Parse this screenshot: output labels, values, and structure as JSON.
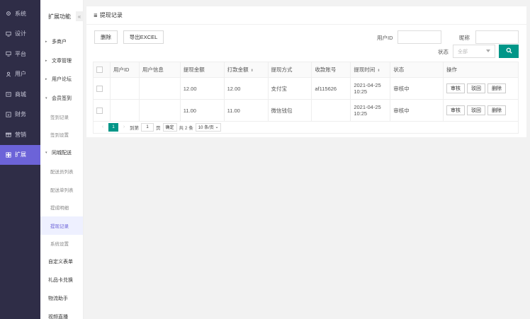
{
  "nav1": [
    {
      "label": "系统",
      "icon": "gear-icon"
    },
    {
      "label": "设计",
      "icon": "monitor-icon"
    },
    {
      "label": "平台",
      "icon": "monitor-icon"
    },
    {
      "label": "用户",
      "icon": "user-icon"
    },
    {
      "label": "商城",
      "icon": "shop-icon"
    },
    {
      "label": "财务",
      "icon": "money-icon"
    },
    {
      "label": "营销",
      "icon": "gift-icon"
    },
    {
      "label": "扩展",
      "icon": "grid-icon"
    }
  ],
  "nav2": {
    "title": "扩展功能",
    "collapse": "«",
    "groups": [
      {
        "label": "多商户",
        "arrow": "▸"
      },
      {
        "label": "文章管理",
        "arrow": "▸"
      },
      {
        "label": "用户论坛",
        "arrow": "▸"
      },
      {
        "label": "会员签到",
        "arrow": "▾"
      }
    ],
    "sign_subs": [
      "签到记录",
      "签到设置"
    ],
    "delivery_group": {
      "label": "同城配送",
      "arrow": "▾"
    },
    "delivery_subs": [
      "配送员列表",
      "配送单列表",
      "提成明细",
      "提现记录",
      "系统设置"
    ],
    "plain": [
      "自定义表单",
      "礼品卡兑换",
      "物流助手",
      "视频直播"
    ]
  },
  "page": {
    "title": "提现记录",
    "delete_btn": "删除",
    "export_btn": "导出EXCEL",
    "uid_label": "用户ID",
    "nick_label": "昵称",
    "status_label": "状态",
    "status_value": "全部"
  },
  "table": {
    "headers": [
      "用户ID",
      "用户信息",
      "提现金额",
      "打款金额",
      "提现方式",
      "收款账号",
      "提现时间",
      "状态",
      "操作"
    ],
    "rows": [
      {
        "uid": "",
        "info": "",
        "amount": "12.00",
        "paid": "12.00",
        "method": "支付宝",
        "account": "af115626",
        "time": "2021-04-25 10:25",
        "status": "审核中"
      },
      {
        "uid": "",
        "info": "",
        "amount": "11.00",
        "paid": "11.00",
        "method": "微信钱包",
        "account": "",
        "time": "2021-04-25 10:25",
        "status": "审核中"
      }
    ],
    "ops": [
      "审核",
      "驳回",
      "删除"
    ]
  },
  "pager": {
    "current": "1",
    "goto_label": "到第",
    "goto_value": "1",
    "page_unit": "页",
    "confirm": "确定",
    "total": "共 2 条",
    "per_page": "10 条/页"
  }
}
